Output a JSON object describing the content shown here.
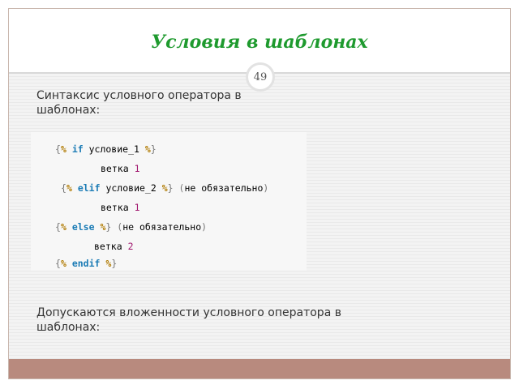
{
  "slide": {
    "title": "Условия в шаблонах",
    "page_number": "49",
    "text1": "Синтаксис условного оператора в шаблонах:",
    "text2": "Допускаются вложенности условного оператора в шаблонах:"
  },
  "code": {
    "open": "{",
    "close": "}",
    "pct": "%",
    "paren_open": "(",
    "paren_close": ")",
    "if_kw": "if",
    "elif_kw": "elif",
    "else_kw": "else",
    "endif_kw": "endif",
    "cond1": "условие_1",
    "cond2": "условие_2",
    "branch_word": "ветка",
    "num1": "1",
    "num2": "2",
    "optional": "не обязательно"
  },
  "colors": {
    "title": "#1e9a2e",
    "keyword": "#1a7bb5",
    "percent": "#b07a00",
    "number": "#a0156d",
    "bottom_bar": "#b88a7e"
  }
}
